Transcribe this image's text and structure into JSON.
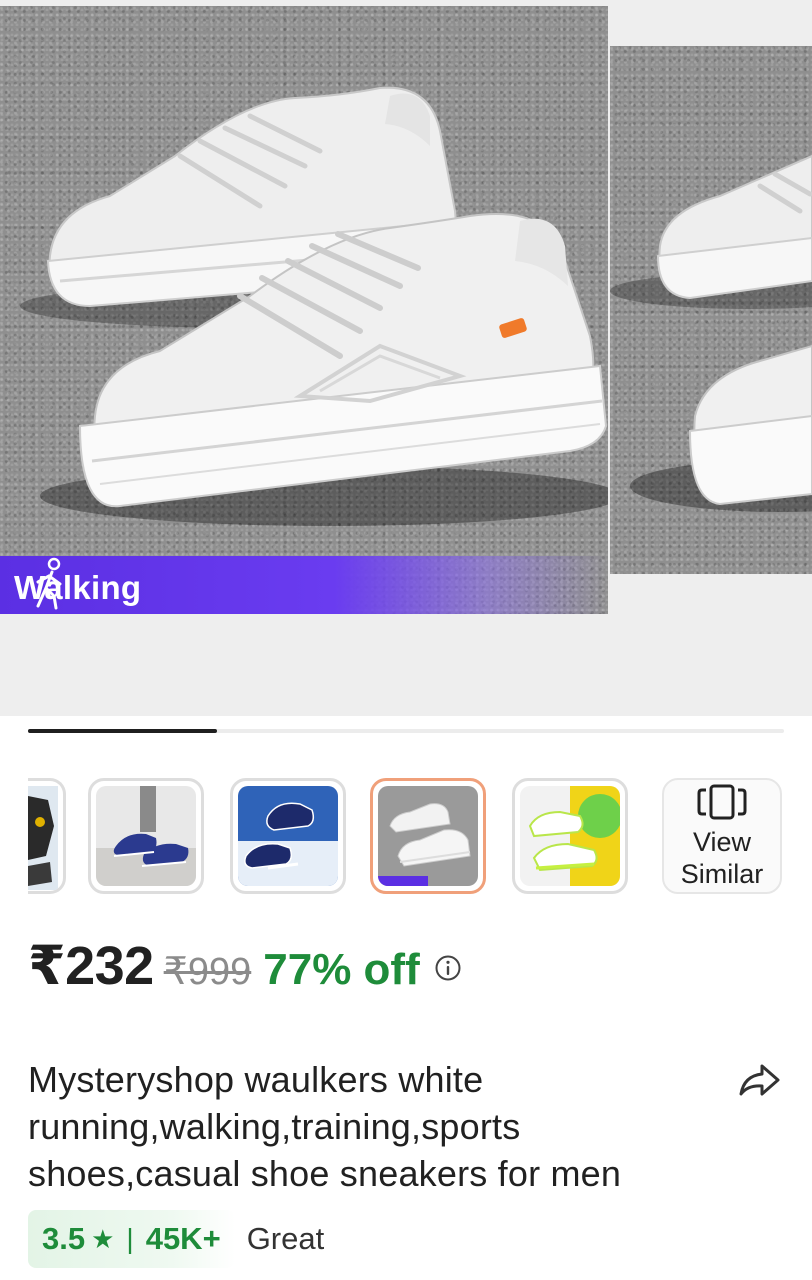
{
  "gallery": {
    "banner_label": "Walking",
    "progress_fraction": 0.25,
    "thumbnails": [
      {
        "name": "thumb-partial"
      },
      {
        "name": "thumb-navy-shoes-worn"
      },
      {
        "name": "thumb-navy-shoes-pair"
      },
      {
        "name": "thumb-white-sneakers",
        "selected": true
      },
      {
        "name": "thumb-white-neon-shoes"
      }
    ],
    "view_similar_label": "View\nSimilar"
  },
  "price": {
    "current": "₹232",
    "mrp": "₹999",
    "discount": "77% off"
  },
  "product": {
    "title": "Mysteryshop waulkers white running,walking,training,sports shoes,casual shoe sneakers for men"
  },
  "rating": {
    "value": "3.5",
    "star": "★",
    "separator": "|",
    "count": "45K+",
    "label": "Great"
  },
  "colors": {
    "accent_purple": "#5b2fe3",
    "discount_green": "#1e8c3a",
    "selected_thumb_border": "#f0a07a"
  }
}
